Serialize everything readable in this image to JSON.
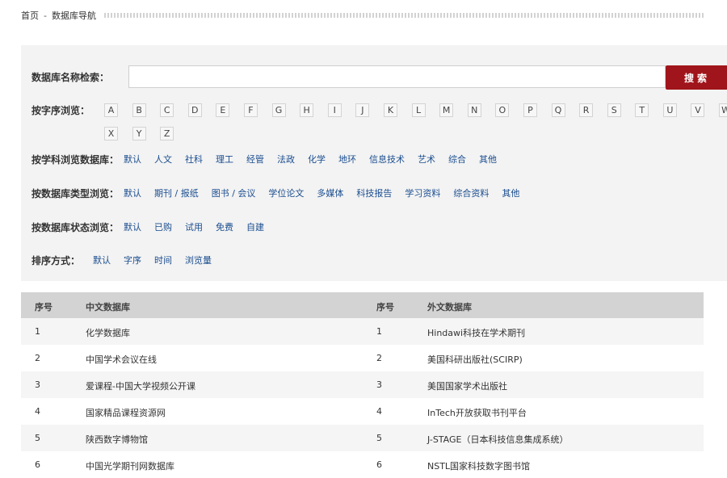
{
  "breadcrumb": {
    "home": "首页",
    "separator": "-",
    "current": "数据库导航"
  },
  "search": {
    "label": "数据库名称检索：",
    "value": "",
    "button": "搜索"
  },
  "alphabet": {
    "label": "按字序浏览：",
    "letters": [
      "A",
      "B",
      "C",
      "D",
      "E",
      "F",
      "G",
      "H",
      "I",
      "J",
      "K",
      "L",
      "M",
      "N",
      "O",
      "P",
      "Q",
      "R",
      "S",
      "T",
      "U",
      "V",
      "W",
      "X",
      "Y",
      "Z"
    ]
  },
  "subject": {
    "label": "按学科浏览数据库：",
    "options": [
      "默认",
      "人文",
      "社科",
      "理工",
      "经管",
      "法政",
      "化学",
      "地环",
      "信息技术",
      "艺术",
      "综合",
      "其他"
    ]
  },
  "db_type": {
    "label": "按数据库类型浏览：",
    "options": [
      "默认",
      "期刊 / 报纸",
      "图书 / 会议",
      "学位论文",
      "多媒体",
      "科技报告",
      "学习资料",
      "综合资料",
      "其他"
    ]
  },
  "db_status": {
    "label": "按数据库状态浏览：",
    "options": [
      "默认",
      "已购",
      "试用",
      "免费",
      "自建"
    ]
  },
  "sort": {
    "label": "排序方式：",
    "options": [
      "默认",
      "字序",
      "时间",
      "浏览量"
    ]
  },
  "table": {
    "headers": [
      "序号",
      "中文数据库",
      "序号",
      "外文数据库"
    ],
    "rows": [
      [
        "1",
        "化学数据库",
        "1",
        "Hindawi科技在学术期刊"
      ],
      [
        "2",
        "中国学术会议在线",
        "2",
        "美国科研出版社(SCIRP)"
      ],
      [
        "3",
        "爱课程-中国大学视频公开课",
        "3",
        "美国国家学术出版社"
      ],
      [
        "4",
        "国家精品课程资源网",
        "4",
        "InTech开放获取书刊平台"
      ],
      [
        "5",
        "陕西数字博物馆",
        "5",
        "J-STAGE（日本科技信息集成系统）"
      ],
      [
        "6",
        "中国光学期刊网数据库",
        "6",
        "NSTL国家科技数字图书馆"
      ]
    ]
  }
}
